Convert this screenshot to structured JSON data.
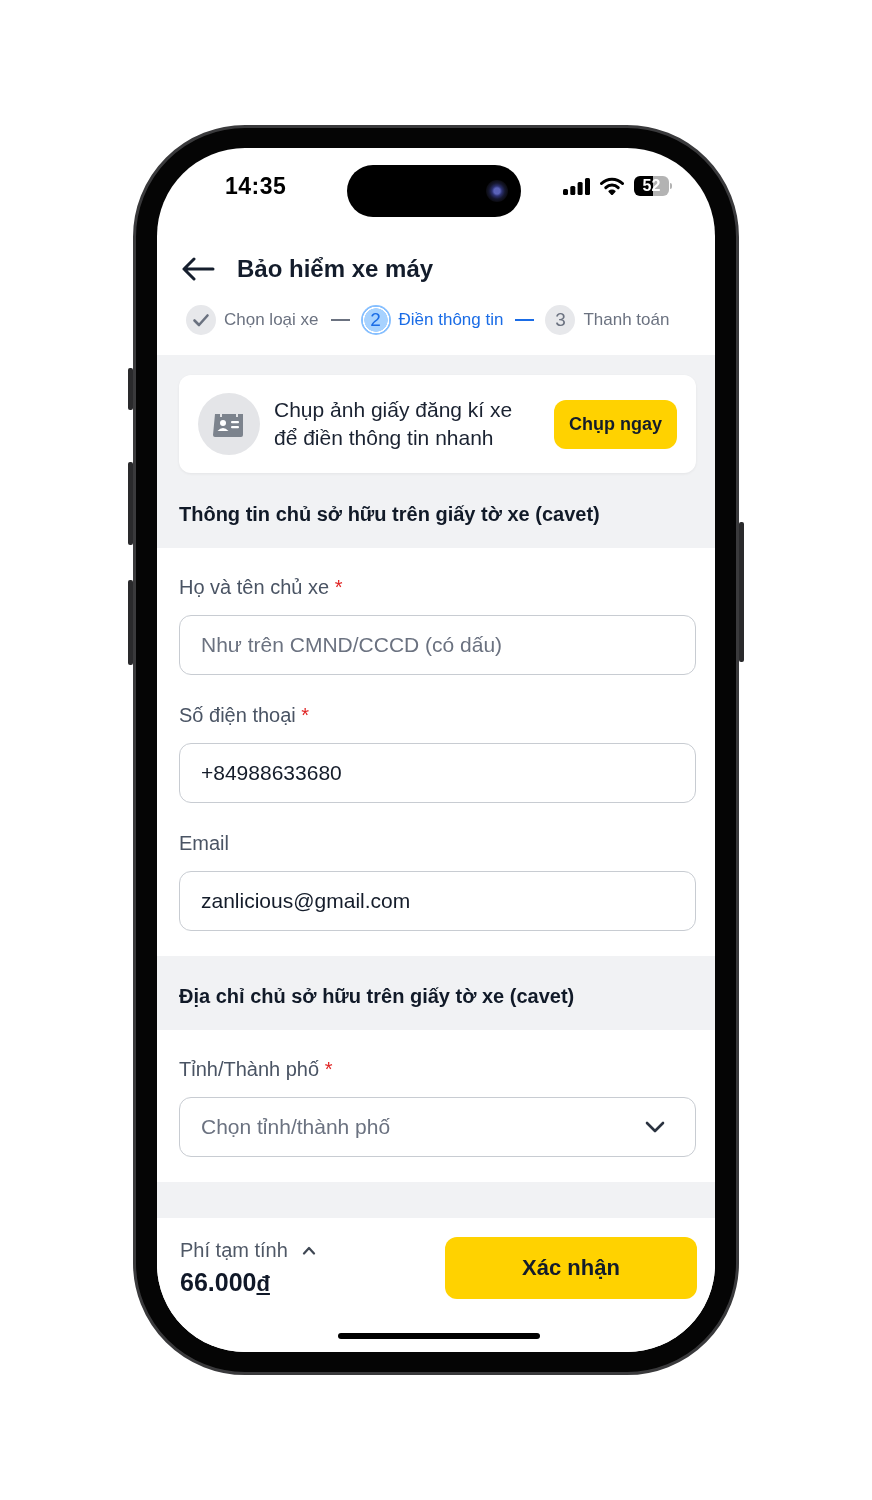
{
  "status_bar": {
    "time": "14:35",
    "battery": "52"
  },
  "header": {
    "title": "Bảo hiểm xe máy"
  },
  "stepper": [
    {
      "label": "Chọn loại xe",
      "completed": true,
      "selected": false
    },
    {
      "number": "2",
      "label": "Điền thông tin",
      "completed": false,
      "selected": true
    },
    {
      "number": "3",
      "label": "Thanh toán",
      "completed": false,
      "selected": false
    }
  ],
  "scan_banner": {
    "text": "Chụp ảnh giấy đăng kí xe để điền thông tin nhanh",
    "button": "Chụp ngay"
  },
  "sections": [
    {
      "title": "Thông tin chủ sở hữu trên giấy tờ xe (cavet)",
      "fields": [
        {
          "kind": "text",
          "label": "Họ và tên chủ xe",
          "required_mark": "*",
          "placeholder": "Như trên CMND/CCCD (có dấu)"
        },
        {
          "kind": "text",
          "label": "Số điện thoại",
          "required_mark": "*",
          "value": "+84988633680"
        },
        {
          "kind": "text",
          "label": "Email",
          "value": "zanlicious@gmail.com"
        }
      ]
    },
    {
      "title": "Địa chỉ chủ sở hữu trên giấy tờ xe (cavet)",
      "fields": [
        {
          "kind": "select",
          "label": "Tỉnh/Thành phố",
          "required_mark": "*",
          "placeholder": "Chọn tỉnh/thành phố"
        }
      ]
    }
  ],
  "footer": {
    "fee_label": "Phí tạm tính",
    "price": {
      "amount": "66.000",
      "currency": "đ"
    },
    "button": "Xác nhận"
  }
}
